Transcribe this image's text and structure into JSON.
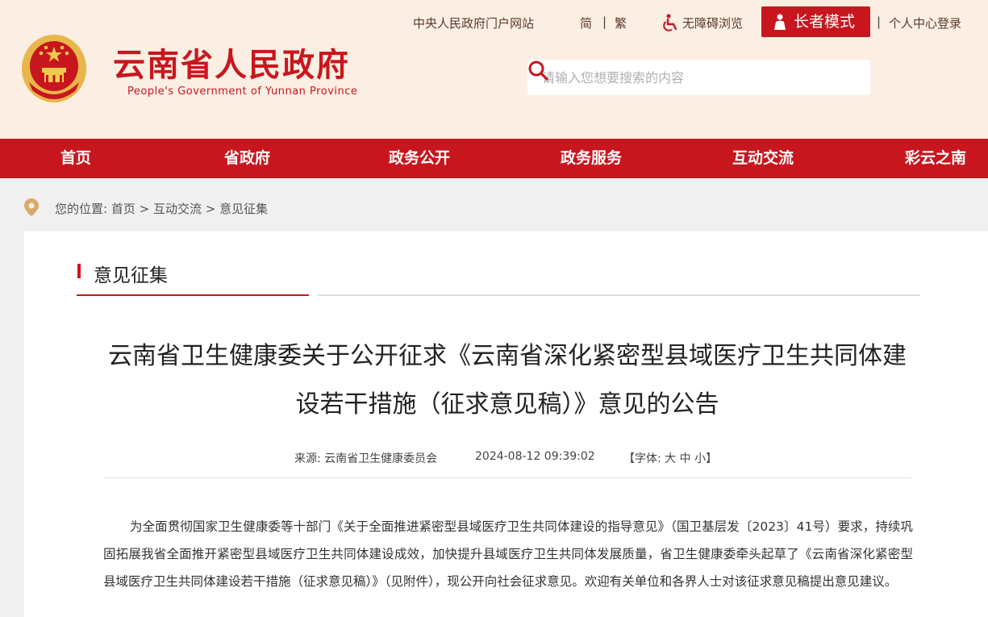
{
  "header": {
    "title": "云南省人民政府",
    "subtitle": "People's Government of Yunnan Province",
    "links": {
      "central_portal": "中央人民政府门户网站",
      "simplified": "简",
      "traditional": "繁",
      "accessibility": "无障碍浏览",
      "elder_mode": "长者模式",
      "user_center": "个人中心登录"
    },
    "search": {
      "placeholder": "请输入您想要搜索的内容"
    }
  },
  "nav": {
    "items": [
      "首页",
      "省政府",
      "政务公开",
      "政务服务",
      "互动交流",
      "彩云之南"
    ]
  },
  "breadcrumb": {
    "prefix": "您的位置:",
    "items": [
      "首页",
      "互动交流",
      "意见征集"
    ],
    "separator": ">"
  },
  "section": {
    "title": "意见征集"
  },
  "article": {
    "title": "云南省卫生健康委关于公开征求《云南省深化紧密型县域医疗卫生共同体建设若干措施（征求意见稿）》意见的公告",
    "source_label": "来源:",
    "source": "云南省卫生健康委员会",
    "datetime": "2024-08-12 09:39:02",
    "font_label": "【字体:",
    "font_large": "大",
    "font_medium": "中",
    "font_small": "小",
    "font_close": "】",
    "body": "为全面贯彻国家卫生健康委等十部门《关于全面推进紧密型县域医疗卫生共同体建设的指导意见》（国卫基层发〔2023〕41号）要求，持续巩固拓展我省全面推开紧密型县域医疗卫生共同体建设成效，加快提升县域医疗卫生共同体发展质量，省卫生健康委牵头起草了《云南省深化紧密型县域医疗卫生共同体建设若干措施（征求意见稿）》（见附件），现公开向社会征求意见。欢迎有关单位和各界人士对该征求意见稿提出意见建议。"
  },
  "colors": {
    "brand_red": "#c8161e",
    "header_bg": "#fbeee3",
    "page_bg": "#f0f0f0"
  }
}
